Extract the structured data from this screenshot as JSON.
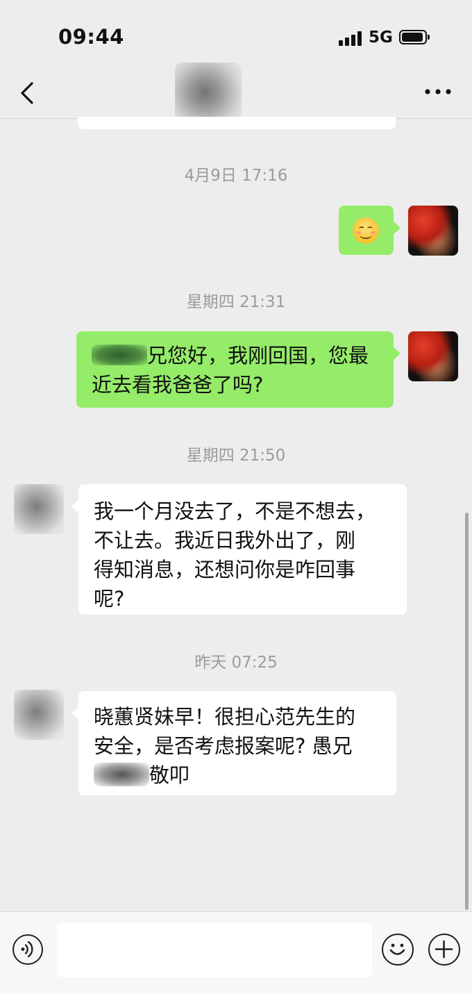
{
  "status_bar": {
    "time": "09:44",
    "network": "5G",
    "icons": [
      "signal-icon",
      "battery-icon"
    ]
  },
  "nav": {
    "title": "",
    "icons": [
      "back-chevron-icon",
      "more-icon"
    ]
  },
  "messages": [
    {
      "type": "timestamp",
      "text": "4月9日 17:16"
    },
    {
      "type": "message",
      "side": "right",
      "content": "smiling-emoji-icon"
    },
    {
      "type": "timestamp",
      "text": "星期四 21:31"
    },
    {
      "type": "message",
      "side": "right",
      "lines": [
        "兄您好，我刚回国，您最",
        "近去看我爸爸了吗?"
      ]
    },
    {
      "type": "timestamp",
      "text": "星期四 21:50"
    },
    {
      "type": "message",
      "side": "left",
      "lines": [
        "我一个月没去了，不是不想去，",
        "不让去。我近日我外出了，刚",
        "得知消息，还想问你是咋回事",
        "呢?"
      ]
    },
    {
      "type": "timestamp",
      "text": "昨天 07:25"
    },
    {
      "type": "message",
      "side": "left",
      "lines": [
        "晓蕙贤妹早！很担心范先生的",
        "安全，是否考虑报案呢? 愚兄",
        "敬叩"
      ]
    }
  ],
  "input_bar": {
    "placeholder": "",
    "icons": [
      "voice-icon",
      "emoji-icon",
      "plus-icon"
    ]
  },
  "colors": {
    "background": "#ededed",
    "outgoing_bubble": "#95ec69",
    "incoming_bubble": "#ffffff",
    "timestamp_text": "#9b9b9b"
  }
}
